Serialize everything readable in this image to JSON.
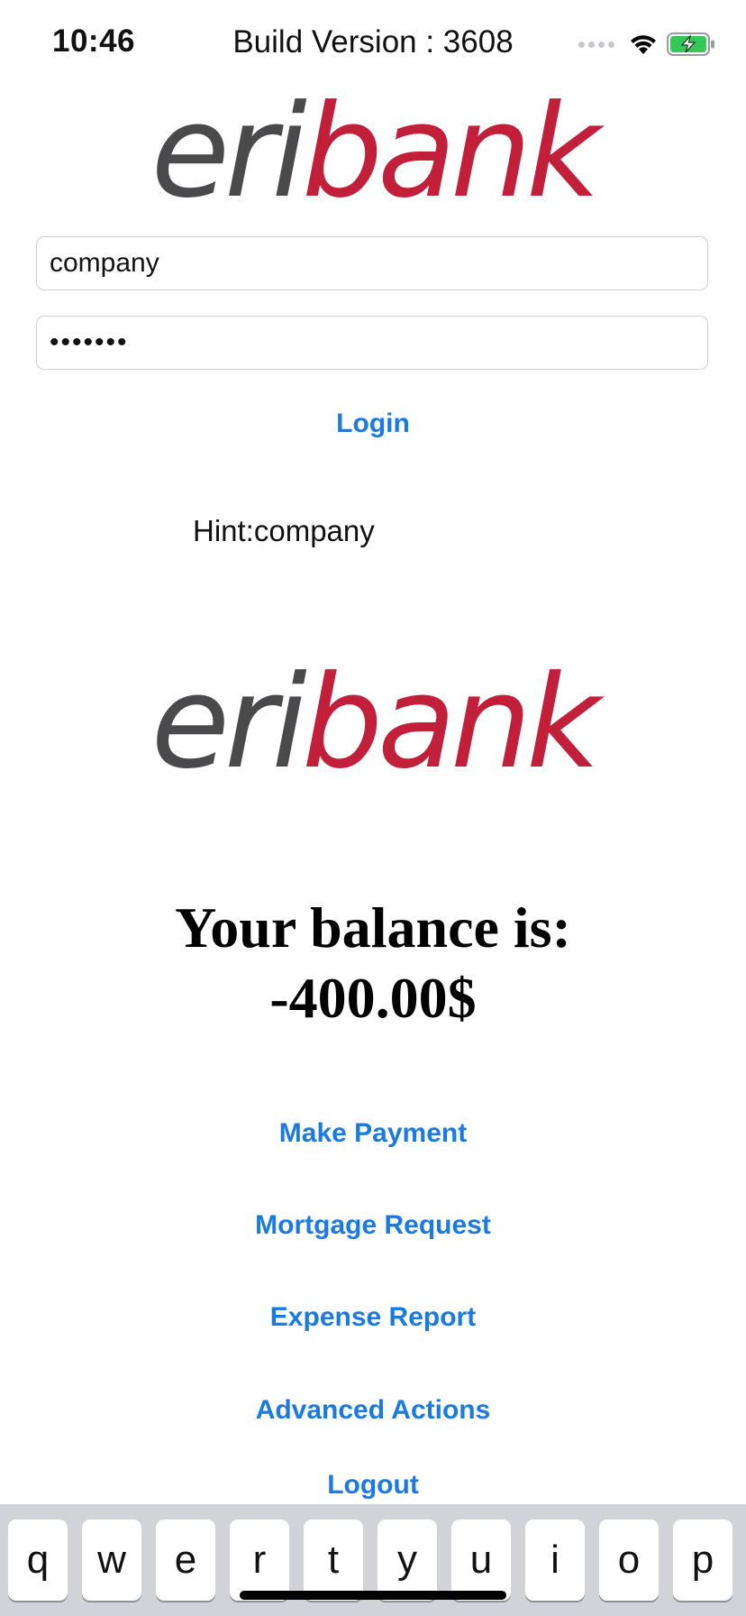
{
  "status_bar": {
    "time": "10:46",
    "title": "Build Version : 3608",
    "icons": [
      "signal-icon",
      "wifi-icon",
      "battery-charging-icon"
    ],
    "battery_color": "#34c759"
  },
  "logo": {
    "part1": "eri",
    "part2": "bank",
    "color_gray": "#4a4a4d",
    "color_red": "#c2203a"
  },
  "login_form": {
    "username_value": "company",
    "password_mask": "•••••••",
    "login_label": "Login",
    "hint": "Hint:company"
  },
  "balance": {
    "label": "Your balance is:",
    "amount": "-400.00$"
  },
  "actions": {
    "make_payment": "Make Payment",
    "mortgage_request": "Mortgage Request",
    "expense_report": "Expense Report",
    "advanced_actions": "Advanced Actions",
    "logout": "Logout"
  },
  "accent_color": "#1a7ae2",
  "keyboard": {
    "keys": [
      "q",
      "w",
      "e",
      "r",
      "t",
      "y",
      "u",
      "i",
      "o",
      "p"
    ]
  }
}
